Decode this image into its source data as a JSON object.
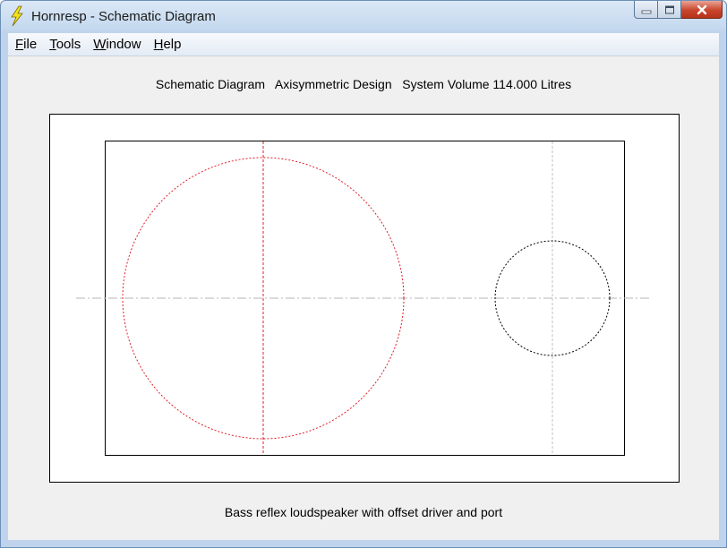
{
  "window": {
    "title": "Hornresp - Schematic Diagram",
    "icon": "lightning-bolt-icon"
  },
  "menu": {
    "items": [
      {
        "first": "F",
        "rest": "ile"
      },
      {
        "first": "T",
        "rest": "ools"
      },
      {
        "first": "W",
        "rest": "indow"
      },
      {
        "first": "H",
        "rest": "elp"
      }
    ]
  },
  "diagram": {
    "header": "Schematic Diagram   Axisymmetric Design   System Volume 114.000 Litres",
    "caption": "Bass reflex loudspeaker with offset driver and port",
    "colors": {
      "driver": "#e0202a",
      "port": "#000000",
      "centerline": "#b4b4b4",
      "frame": "#000000"
    }
  }
}
